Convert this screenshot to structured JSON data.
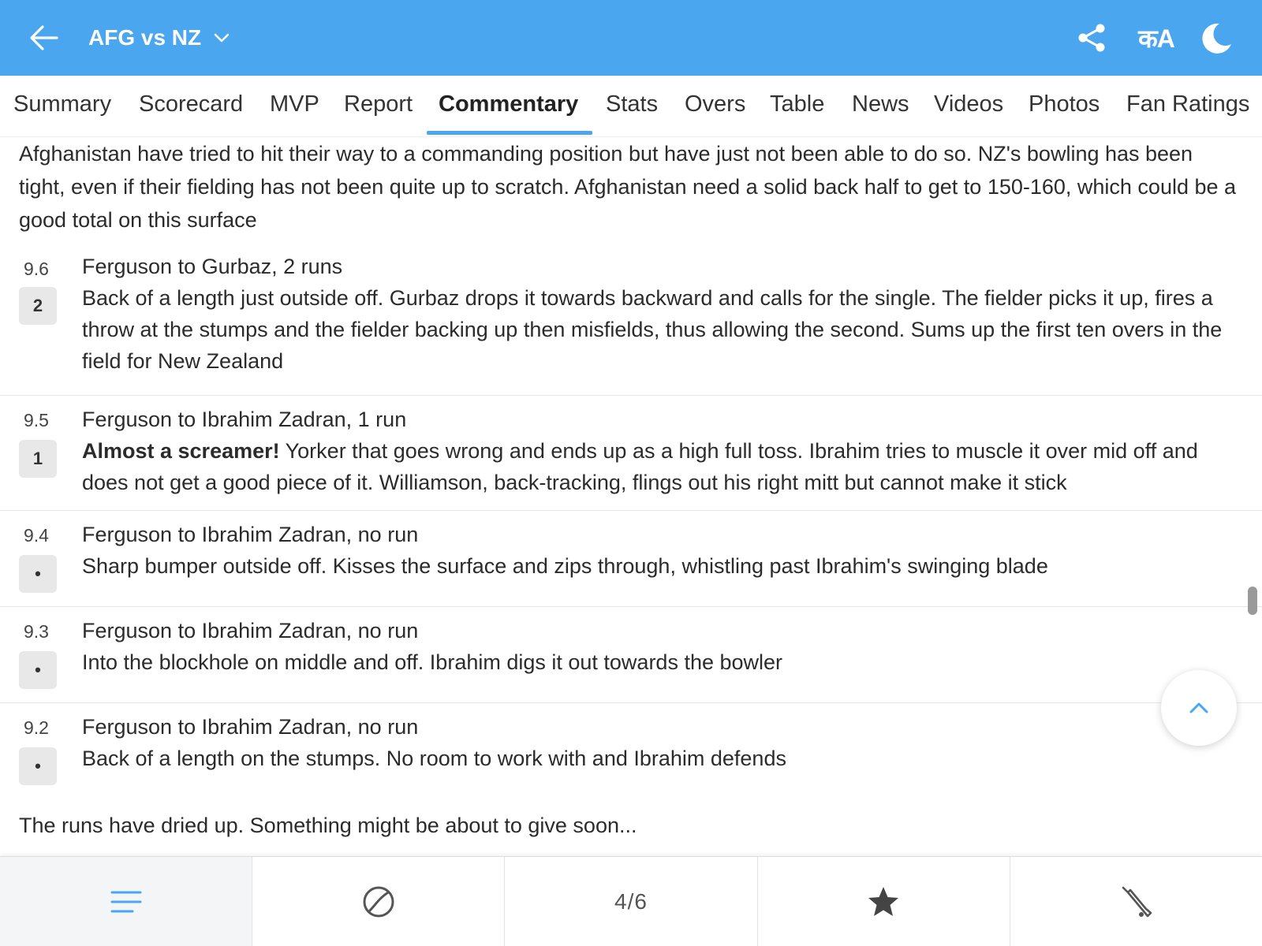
{
  "header": {
    "title": "AFG vs NZ",
    "lang_label": "कA",
    "icons": [
      "back-arrow-icon",
      "chevron-down-icon",
      "share-icon",
      "language-icon",
      "moon-icon"
    ]
  },
  "tabs": [
    {
      "label": "Summary"
    },
    {
      "label": "Scorecard"
    },
    {
      "label": "MVP"
    },
    {
      "label": "Report"
    },
    {
      "label": "Commentary",
      "active": true
    },
    {
      "label": "Stats"
    },
    {
      "label": "Overs"
    },
    {
      "label": "Table"
    },
    {
      "label": "News"
    },
    {
      "label": "Videos"
    },
    {
      "label": "Photos"
    },
    {
      "label": "Fan Ratings"
    }
  ],
  "commentary": {
    "intro": "Afghanistan have tried to hit their way to a commanding position but have just not been able to do so. NZ's bowling has been tight, even if their fielding has not been quite up to scratch. Afghanistan need a solid back half to get to 150-160, which could be a good total on this surface",
    "balls": [
      {
        "over": "9.6",
        "runs": "2",
        "headline": "Ferguson to Gurbaz, 2 runs",
        "highlight": "",
        "text": "Back of a length just outside off. Gurbaz drops it towards backward and calls for the single. The fielder picks it up, fires a throw at the stumps and the fielder backing up then misfields, thus allowing the second. Sums up the first ten overs in the field for New Zealand"
      },
      {
        "over": "9.5",
        "runs": "1",
        "headline": "Ferguson to Ibrahim Zadran, 1 run",
        "highlight": "Almost a screamer!",
        "text": "Yorker that goes wrong and ends up as a high full toss. Ibrahim tries to muscle it over mid off and does not get a good piece of it. Williamson, back-tracking, flings out his right mitt but cannot make it stick"
      },
      {
        "over": "9.4",
        "runs": "•",
        "headline": "Ferguson to Ibrahim Zadran, no run",
        "highlight": "",
        "text": "Sharp bumper outside off. Kisses the surface and zips through, whistling past Ibrahim's swinging blade"
      },
      {
        "over": "9.3",
        "runs": "•",
        "headline": "Ferguson to Ibrahim Zadran, no run",
        "highlight": "",
        "text": "Into the blockhole on middle and off. Ibrahim digs it out towards the bowler"
      },
      {
        "over": "9.2",
        "runs": "•",
        "headline": "Ferguson to Ibrahim Zadran, no run",
        "highlight": "",
        "text": "Back of a length on the stumps. No room to work with and Ibrahim defends"
      }
    ],
    "outro": "The runs have dried up. Something might be about to give soon..."
  },
  "bottom_bar": {
    "items": [
      "menu-lines-icon",
      "ball-icon",
      "count",
      "star-icon",
      "bat-icon"
    ],
    "count_label": "4/6",
    "active": "menu-lines-icon"
  },
  "colors": {
    "header_bg": "#4aa6ee",
    "accent": "#4aa6ee",
    "badge_bg": "#e8e8e8"
  }
}
